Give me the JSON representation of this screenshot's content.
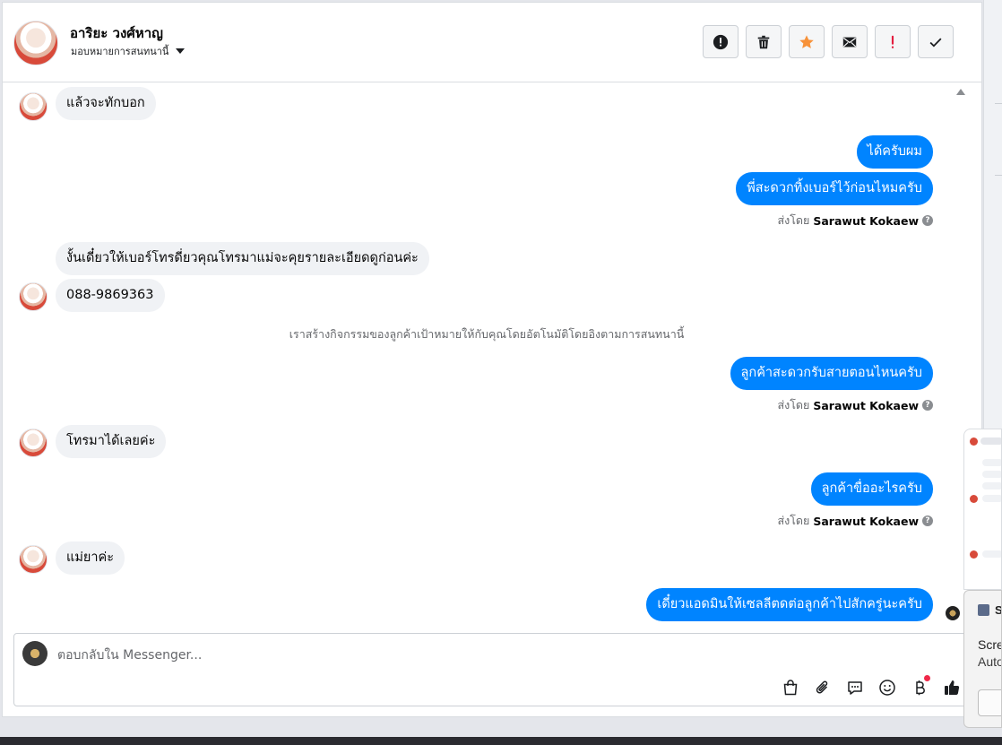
{
  "header": {
    "contact_name": "อาริยะ วงศ์หาญ",
    "assign_label": "มอบหมายการสนทนานี้",
    "actions": [
      {
        "name": "spam-button",
        "icon": "alert-circle-icon"
      },
      {
        "name": "delete-button",
        "icon": "trash-icon"
      },
      {
        "name": "star-button",
        "icon": "star-icon"
      },
      {
        "name": "mark-unread-button",
        "icon": "envelope-icon"
      },
      {
        "name": "follow-up-button",
        "icon": "exclamation-icon"
      },
      {
        "name": "mark-done-button",
        "icon": "check-icon"
      }
    ],
    "colors": {
      "star": "#f7923a",
      "follow_up": "#e41e3f"
    }
  },
  "thread": {
    "messages": [
      {
        "dir": "in",
        "text": "แล้วจะทักบอก"
      },
      {
        "dir": "out",
        "text": "ได้ครับผม"
      },
      {
        "dir": "out",
        "text": "พี่สะดวกทิ้งเบอร์ไว้ก่อนไหมครับ"
      },
      {
        "dir": "in",
        "text": "งั้นเดี๋ยวให้เบอร์โทรดี่ยวคุณโทรมาแม่จะคุยรายละเอียดดูก่อนค่ะ"
      },
      {
        "dir": "in",
        "text": "088-9869363"
      },
      {
        "dir": "out",
        "text": "ลูกค้าสะดวกรับสายตอนไหนครับ"
      },
      {
        "dir": "in",
        "text": "โทรมาได้เลยค่ะ"
      },
      {
        "dir": "out",
        "text": "ลูกค้าขื่ออะไรครับ"
      },
      {
        "dir": "in",
        "text": "แม่ยาค่ะ"
      },
      {
        "dir": "out",
        "text": "เดี๋ยวแอดมินให้เซลลีตดต่อลูกค้าไปสักครู่นะครับ"
      }
    ],
    "sent_by_prefix": "ส่งโดย",
    "sent_by_name": "Sarawut Kokaew",
    "system_note": "เราสร้างกิจกรรมของลูกค้าเป้าหมายให้กับคุณโดยอัตโนมัติโดยอิงตามการสนทนานี้",
    "colors": {
      "outgoing": "#0084ff",
      "incoming": "#f0f2f5"
    }
  },
  "composer": {
    "placeholder": "ตอบกลับใน Messenger...",
    "tools": [
      "shopping-bag-icon",
      "paperclip-icon",
      "saved-reply-icon",
      "emoji-icon",
      "baht-icon",
      "thumbs-up-icon"
    ]
  },
  "notification": {
    "app": "S",
    "title": "Scre",
    "body": "Auto"
  }
}
